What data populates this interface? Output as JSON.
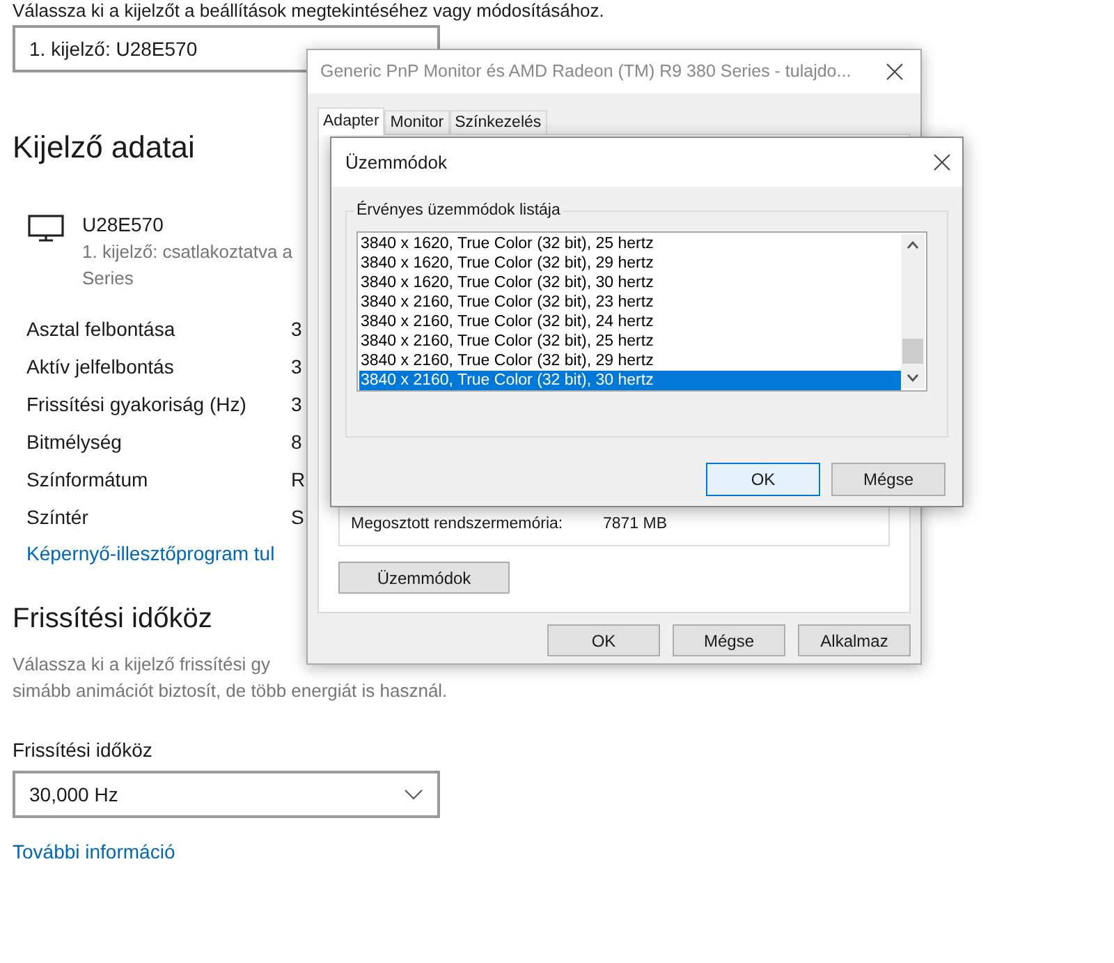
{
  "header_text": "Válassza ki a kijelzőt a beállítások megtekintéséhez vagy módosításához.",
  "display_select": {
    "value": "1. kijelző: U28E570"
  },
  "section_title": "Kijelző adatai",
  "monitor": {
    "name": "U28E570",
    "detail_lines": [
      "1. kijelző: csatlakoztatva a",
      "Series"
    ]
  },
  "properties": [
    {
      "label": "Asztal felbontása",
      "value": "3"
    },
    {
      "label": "Aktív jelfelbontás",
      "value": "3"
    },
    {
      "label": "Frissítési gyakoriság (Hz)",
      "value": "3"
    },
    {
      "label": "Bitmélység",
      "value": "8"
    },
    {
      "label": "Színformátum",
      "value": "R"
    },
    {
      "label": "Színtér",
      "value": "S"
    }
  ],
  "adapter_link": "Képernyő-illesztőprogram tul",
  "refresh_section": {
    "title": "Frissítési időköz",
    "description_lines": [
      "Válassza ki a kijelző frissítési gy",
      "simább animációt biztosít, de több energiát is használ."
    ],
    "field_label": "Frissítési időköz",
    "select_value": "30,000 Hz",
    "more_link": "További információ"
  },
  "properties_dialog": {
    "title": "Generic PnP Monitor és AMD Radeon (TM) R9 380 Series - tulajdo...",
    "tabs": [
      {
        "label": "Adapter",
        "selected": true
      },
      {
        "label": "Monitor",
        "selected": false
      },
      {
        "label": "Színkezelés",
        "selected": false
      }
    ],
    "shared_memory_label": "Megosztott rendszermemória:",
    "shared_memory_value": "7871 MB",
    "modes_button": "Üzemmódok",
    "buttons": [
      "OK",
      "Mégse",
      "Alkalmaz"
    ]
  },
  "modes_dialog": {
    "title": "Üzemmódok",
    "group_label": "Érvényes üzemmódok listája",
    "modes": [
      {
        "label": "3840 x 1620, True Color (32 bit), 25 hertz",
        "selected": false
      },
      {
        "label": "3840 x 1620, True Color (32 bit), 29 hertz",
        "selected": false
      },
      {
        "label": "3840 x 1620, True Color (32 bit), 30 hertz",
        "selected": false
      },
      {
        "label": "3840 x 2160, True Color (32 bit), 23 hertz",
        "selected": false
      },
      {
        "label": "3840 x 2160, True Color (32 bit), 24 hertz",
        "selected": false
      },
      {
        "label": "3840 x 2160, True Color (32 bit), 25 hertz",
        "selected": false
      },
      {
        "label": "3840 x 2160, True Color (32 bit), 29 hertz",
        "selected": false
      },
      {
        "label": "3840 x 2160, True Color (32 bit), 30 hertz",
        "selected": true
      }
    ],
    "buttons": [
      {
        "label": "OK",
        "default": true
      },
      {
        "label": "Mégse",
        "default": false
      }
    ]
  }
}
